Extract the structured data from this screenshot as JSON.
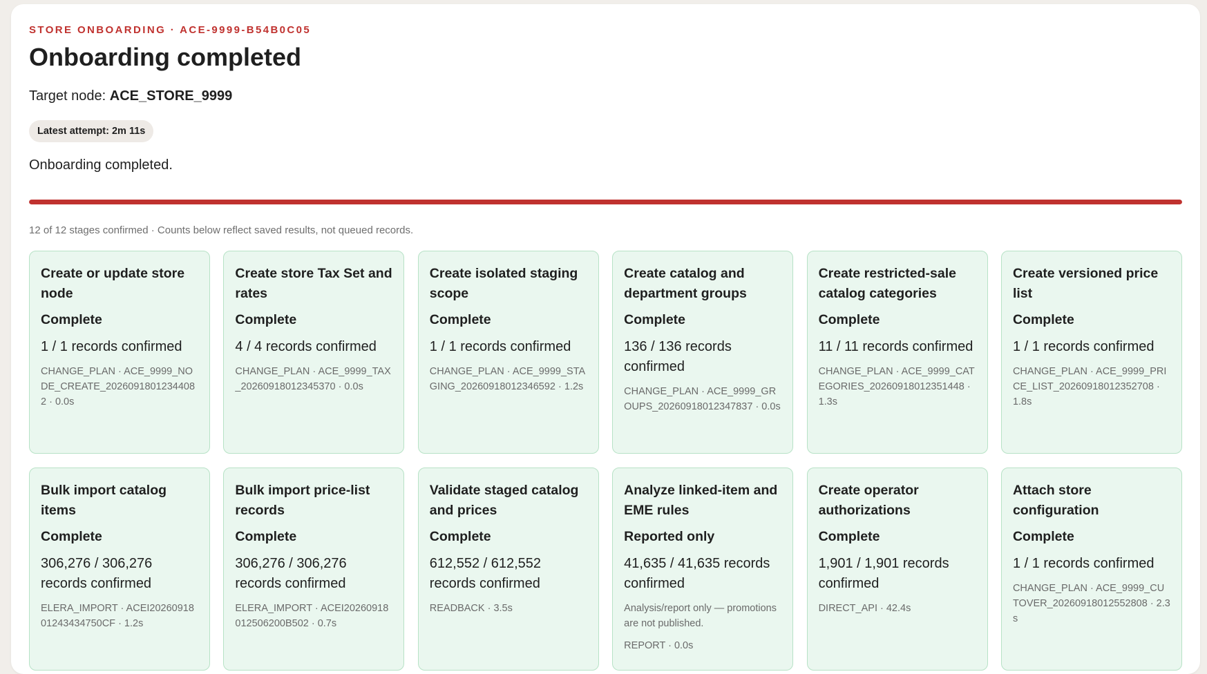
{
  "header": {
    "eyebrow": "STORE ONBOARDING · ACE-9999-B54B0C05",
    "title": "Onboarding completed",
    "target_label": "Target node:",
    "target_value": "ACE_STORE_9999",
    "attempt_pill": "Latest attempt: 2m 11s",
    "message": "Onboarding completed."
  },
  "progress": {
    "fraction": 1.0,
    "summary": "12 of 12 stages confirmed · Counts below reflect saved results, not queued records."
  },
  "colors": {
    "accent": "#c0322f",
    "card_bg": "#eaf7ef",
    "card_border": "#b7e2c6"
  },
  "stages": [
    {
      "title": "Create or update store node",
      "status": "Complete",
      "count": "1 / 1 records confirmed",
      "note": "",
      "meta": "CHANGE_PLAN · ACE_9999_NODE_CREATE_20260918012344082 · 0.0s"
    },
    {
      "title": "Create store Tax Set and rates",
      "status": "Complete",
      "count": "4 / 4 records confirmed",
      "note": "",
      "meta": "CHANGE_PLAN · ACE_9999_TAX_20260918012345370 · 0.0s"
    },
    {
      "title": "Create isolated staging scope",
      "status": "Complete",
      "count": "1 / 1 records confirmed",
      "note": "",
      "meta": "CHANGE_PLAN · ACE_9999_STAGING_20260918012346592 · 1.2s"
    },
    {
      "title": "Create catalog and department groups",
      "status": "Complete",
      "count": "136 / 136 records confirmed",
      "note": "",
      "meta": "CHANGE_PLAN · ACE_9999_GROUPS_20260918012347837 · 0.0s"
    },
    {
      "title": "Create restricted-sale catalog categories",
      "status": "Complete",
      "count": "11 / 11 records confirmed",
      "note": "",
      "meta": "CHANGE_PLAN · ACE_9999_CATEGORIES_20260918012351448 · 1.3s"
    },
    {
      "title": "Create versioned price list",
      "status": "Complete",
      "count": "1 / 1 records confirmed",
      "note": "",
      "meta": "CHANGE_PLAN · ACE_9999_PRICE_LIST_20260918012352708 · 1.8s"
    },
    {
      "title": "Bulk import catalog items",
      "status": "Complete",
      "count": "306,276 / 306,276 records confirmed",
      "note": "",
      "meta": "ELERA_IMPORT · ACEI2026091801243434750CF · 1.2s"
    },
    {
      "title": "Bulk import price-list records",
      "status": "Complete",
      "count": "306,276 / 306,276 records confirmed",
      "note": "",
      "meta": "ELERA_IMPORT · ACEI2026091801250620​0B502 · 0.7s"
    },
    {
      "title": "Validate staged catalog and prices",
      "status": "Complete",
      "count": "612,552 / 612,552 records confirmed",
      "note": "",
      "meta": "READBACK · 3.5s"
    },
    {
      "title": "Analyze linked-item and EME rules",
      "status": "Reported only",
      "count": "41,635 / 41,635 records confirmed",
      "note": "Analysis/report only — promotions are not published.",
      "meta": "REPORT · 0.0s"
    },
    {
      "title": "Create operator authorizations",
      "status": "Complete",
      "count": "1,901 / 1,901 records confirmed",
      "note": "",
      "meta": "DIRECT_API · 42.4s"
    },
    {
      "title": "Attach store configuration",
      "status": "Complete",
      "count": "1 / 1 records confirmed",
      "note": "",
      "meta": "CHANGE_PLAN · ACE_9999_CUTOVER_20260918012552808 · 2.3s"
    }
  ]
}
